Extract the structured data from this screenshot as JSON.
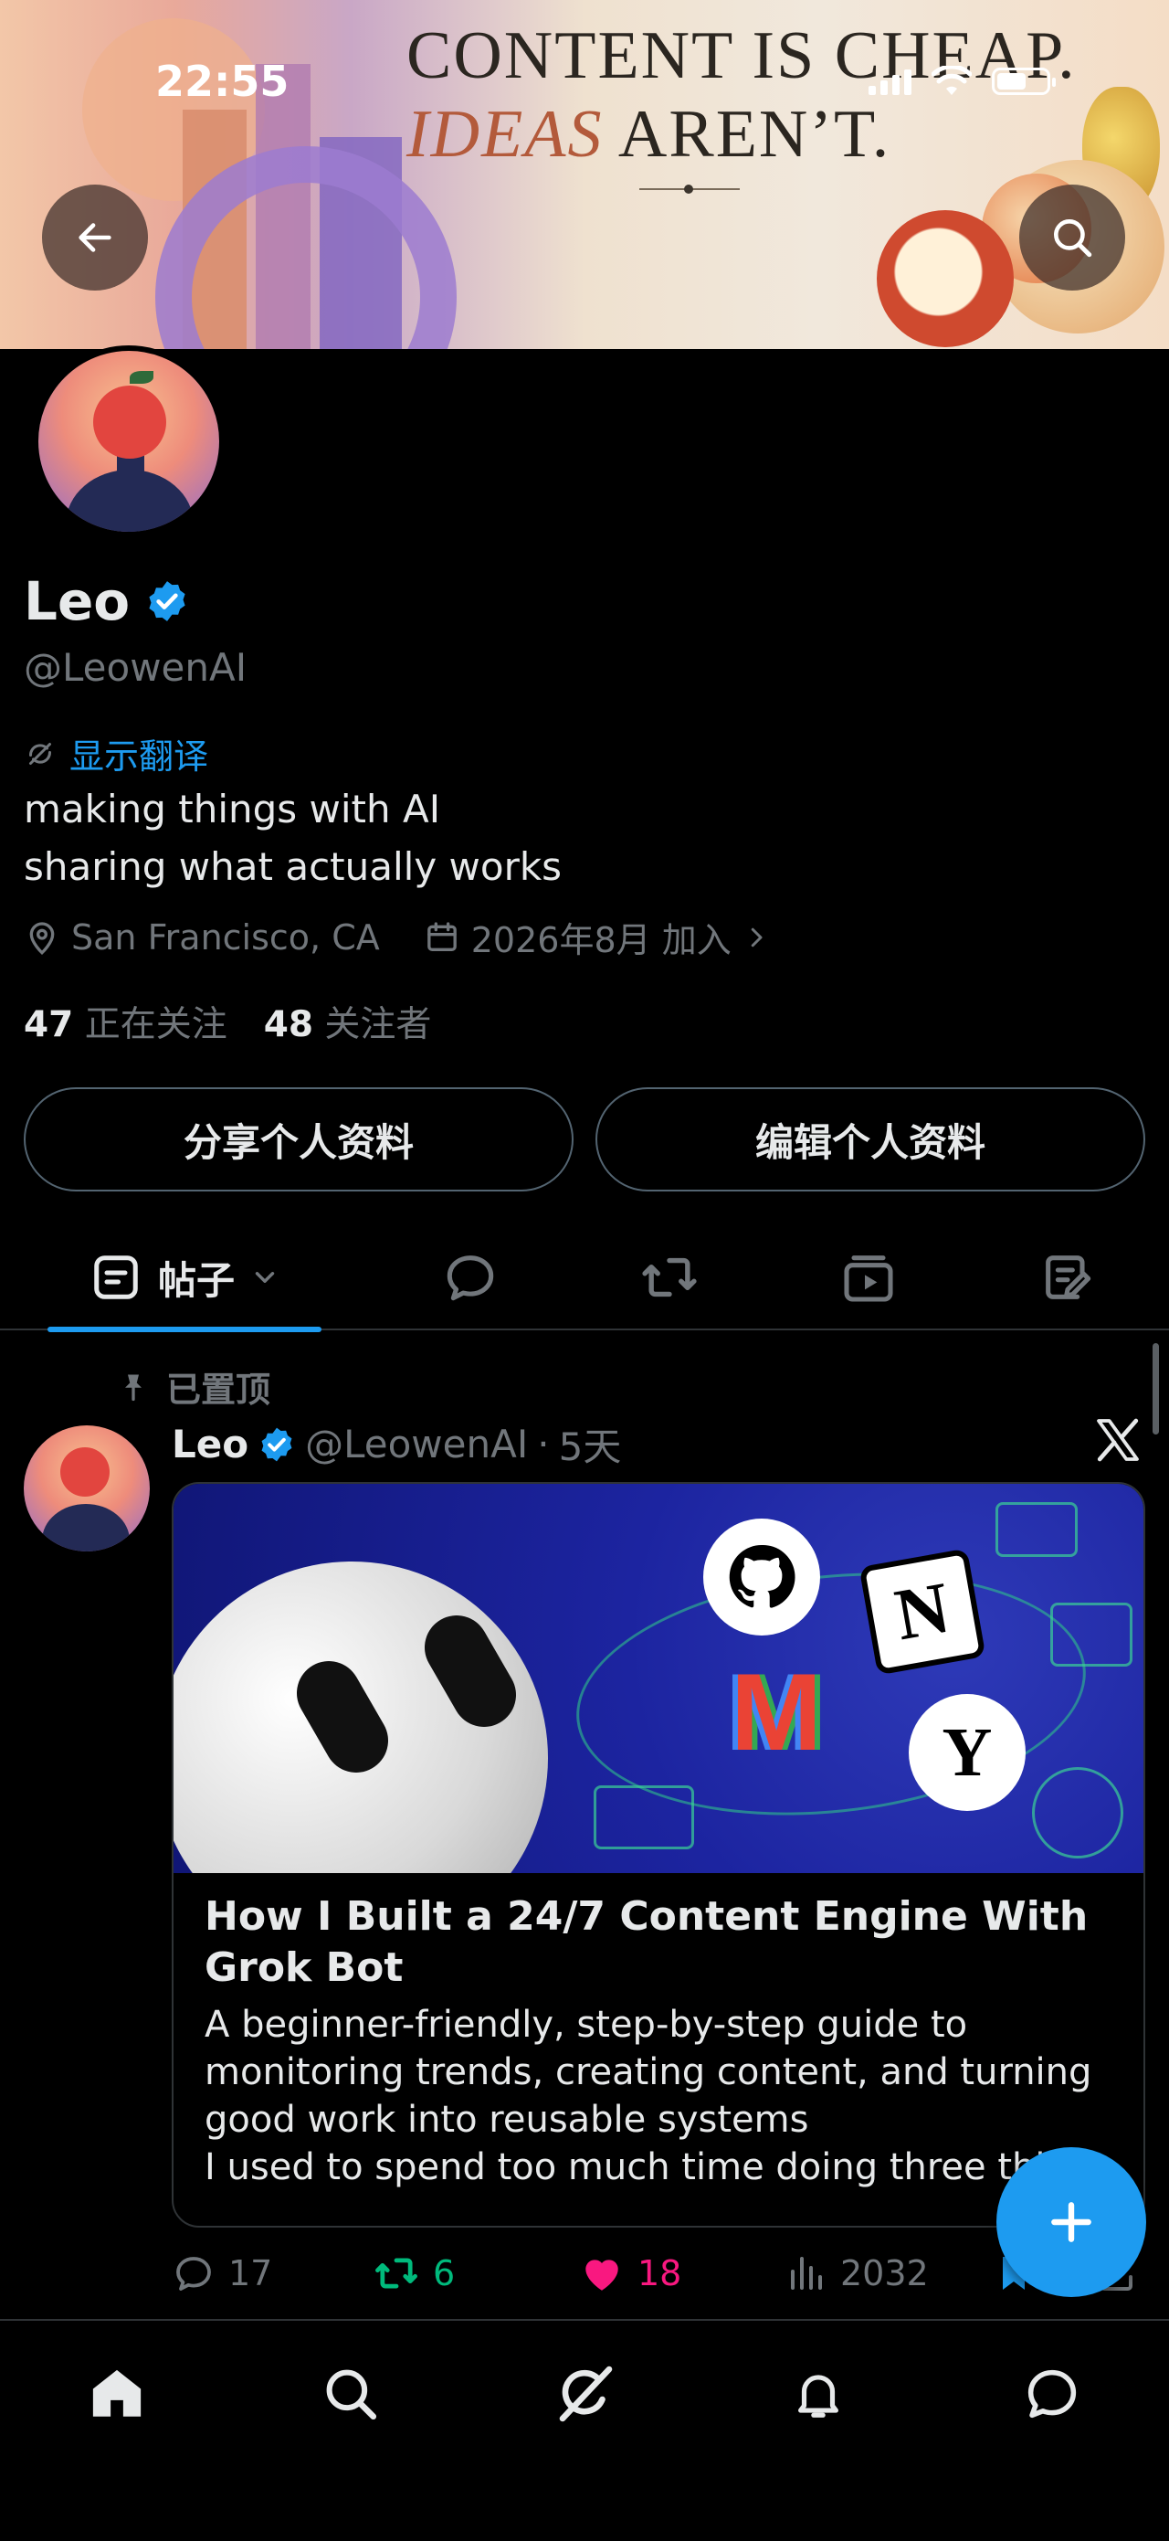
{
  "status_bar": {
    "time": "22:55"
  },
  "banner": {
    "line1": "CONTENT IS CHEAP.",
    "line2_emph": "IDEAS",
    "line2_rest": "AREN’T."
  },
  "profile": {
    "name": "Leo",
    "handle": "@LeowenAI",
    "translate_link": "显示翻译",
    "bio_line1": "making things with AI",
    "bio_line2": "sharing what actually works",
    "location": "San Francisco, CA",
    "joined": "2026年8月 加入",
    "following_count": "47",
    "following_label": "正在关注",
    "followers_count": "48",
    "followers_label": "关注者"
  },
  "buttons": {
    "share_profile": "分享个人资料",
    "edit_profile": "编辑个人资料"
  },
  "tabs": {
    "posts_label": "帖子",
    "icons": [
      "posts-icon",
      "replies-icon",
      "reposts-icon",
      "media-icon",
      "articles-icon"
    ]
  },
  "post": {
    "pinned_label": "已置顶",
    "author_name": "Leo",
    "author_handle": "@LeowenAI",
    "separator": "·",
    "time_ago": "5天",
    "card_title": "How I Built a 24/7 Content Engine With Grok Bot",
    "card_desc": "A beginner-friendly, step-by-step guide to monitoring trends, creating content, and turning good work into reusable systems\nI used to spend too much time doing three thin",
    "reply_count": "17",
    "repost_count": "6",
    "like_count": "18",
    "view_count": "2032"
  },
  "colors": {
    "accent": "#1d9bf0",
    "repost_green": "#00ba7c",
    "like_pink": "#f91880",
    "muted": "#71767b",
    "background": "#000000"
  }
}
